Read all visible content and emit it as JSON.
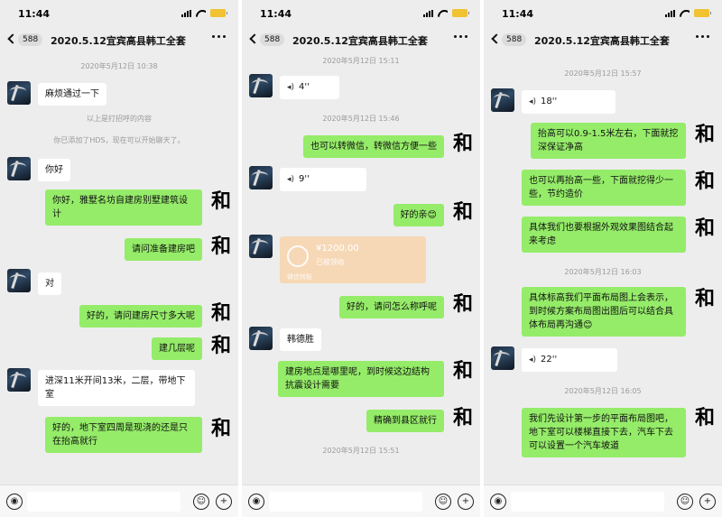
{
  "status": {
    "time": "11:44"
  },
  "chat": {
    "unread": "588",
    "title": "2020.5.12宜宾高县韩工全套"
  },
  "avatar_right_char": "和",
  "panel1": {
    "ts1": "2020年5月12日 10:38",
    "msg1": "麻烦通过一下",
    "sys1": "以上是打招呼的内容",
    "sys2": "你已添加了HDS，现在可以开始聊天了。",
    "msg2": "你好",
    "msg3": "你好，雅墅名坊自建房别墅建筑设计",
    "msg4": "请问准备建房吧",
    "msg5": "对",
    "msg6": "好的，请问建房尺寸多大呢",
    "msg7": "建几层呢",
    "msg8": "进深11米开间13米，二层，带地下室",
    "msg9": "好的，地下室四周是现浇的还是只在抬高就行"
  },
  "panel2": {
    "ts0": "2020年5月12日 15:11",
    "voice1": "4''",
    "ts1": "2020年5月12日 15:46",
    "msg1": "也可以转微信，转微信方便一些",
    "voice2": "9''",
    "msg2": "好的亲😊",
    "transfer_amount": "¥1200.00",
    "transfer_status": "已被领收",
    "transfer_label": "微信转账",
    "msg3": "好的，请问怎么称呼呢",
    "msg4": "韩德胜",
    "msg5": "建房地点是哪里呢，到时候这边结构抗震设计需要",
    "msg6": "精确到县区就行",
    "ts2": "2020年5月12日 15:51"
  },
  "panel3": {
    "ts1": "2020年5月12日 15:57",
    "voice1": "18''",
    "msg1": "抬高可以0.9-1.5米左右，下面就挖深保证净高",
    "msg2": "也可以再抬高一些，下面就挖得少一些，节约造价",
    "msg3": "具体我们也要根据外观效果图结合起来考虑",
    "ts2": "2020年5月12日 16:03",
    "msg4": "具体标高我们平面布局图上会表示，到时候方案布局图出图后可以结合具体布局再沟通😊",
    "voice2": "22''",
    "ts3": "2020年5月12日 16:05",
    "msg5": "我们先设计第一步的平面布局图吧，地下室可以楼梯直接下去，汽车下去可以设置一个汽车坡道"
  }
}
